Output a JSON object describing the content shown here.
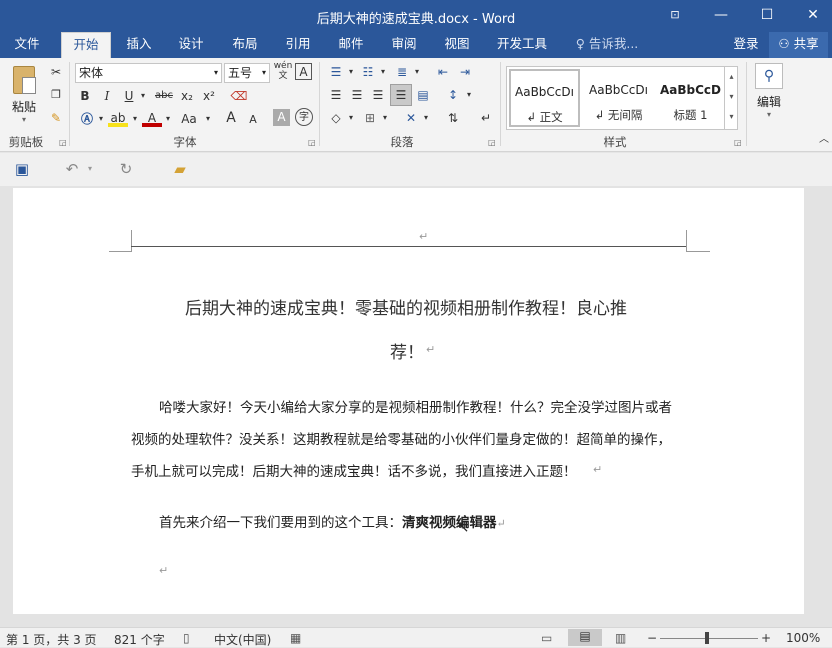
{
  "window": {
    "title": "后期大神的速成宝典.docx - Word"
  },
  "menu": {
    "tabs": [
      "文件",
      "开始",
      "插入",
      "设计",
      "布局",
      "引用",
      "邮件",
      "审阅",
      "视图",
      "开发工具"
    ],
    "tell_me": "告诉我...",
    "login": "登录",
    "share": "共享"
  },
  "ribbon": {
    "clipboard": {
      "paste": "粘贴",
      "label": "剪贴板"
    },
    "font": {
      "name": "宋体",
      "size": "五号",
      "label": "字体",
      "bold": "B",
      "italic": "I",
      "underline": "U",
      "strike": "abc",
      "sub": "x₂",
      "sup": "x²",
      "case": "Aa",
      "grow": "A",
      "shrink": "A",
      "font_color": "A",
      "char_shade": "A",
      "enclose": "字",
      "phonetic": "wén",
      "border": "A"
    },
    "paragraph": {
      "label": "段落"
    },
    "styles": {
      "label": "样式",
      "items": [
        {
          "preview": "AaBbCcDı",
          "name": "↲ 正文"
        },
        {
          "preview": "AaBbCcDı",
          "name": "↲ 无间隔"
        },
        {
          "preview": "AaBbCcD",
          "name": "标题 1"
        }
      ]
    },
    "editing": {
      "label": "编辑"
    }
  },
  "document": {
    "header_mark": "↵",
    "title_line1": "后期大神的速成宝典！零基础的视频相册制作教程！良心推",
    "title_line2": "荐！",
    "para_mark": "↵",
    "body_lines": [
      "哈喽大家好！今天小编给大家分享的是视频相册制作教程！什么？完全没学过图片或者",
      "视频的处理软件？没关系！这期教程就是给零基础的小伙伴们量身定做的！超简单的操作，",
      "手机上就可以完成！后期大神的速成宝典！话不多说，我们直接进入正题！"
    ],
    "intro": "首先来介绍一下我们要用到的这个工具：",
    "tool_name": "清爽视频编辑器"
  },
  "status": {
    "page": "第 1 页，共 3 页",
    "words": "821 个字",
    "lang": "中文(中国)",
    "zoom": "100%",
    "zoom_minus": "−",
    "zoom_plus": "+"
  }
}
